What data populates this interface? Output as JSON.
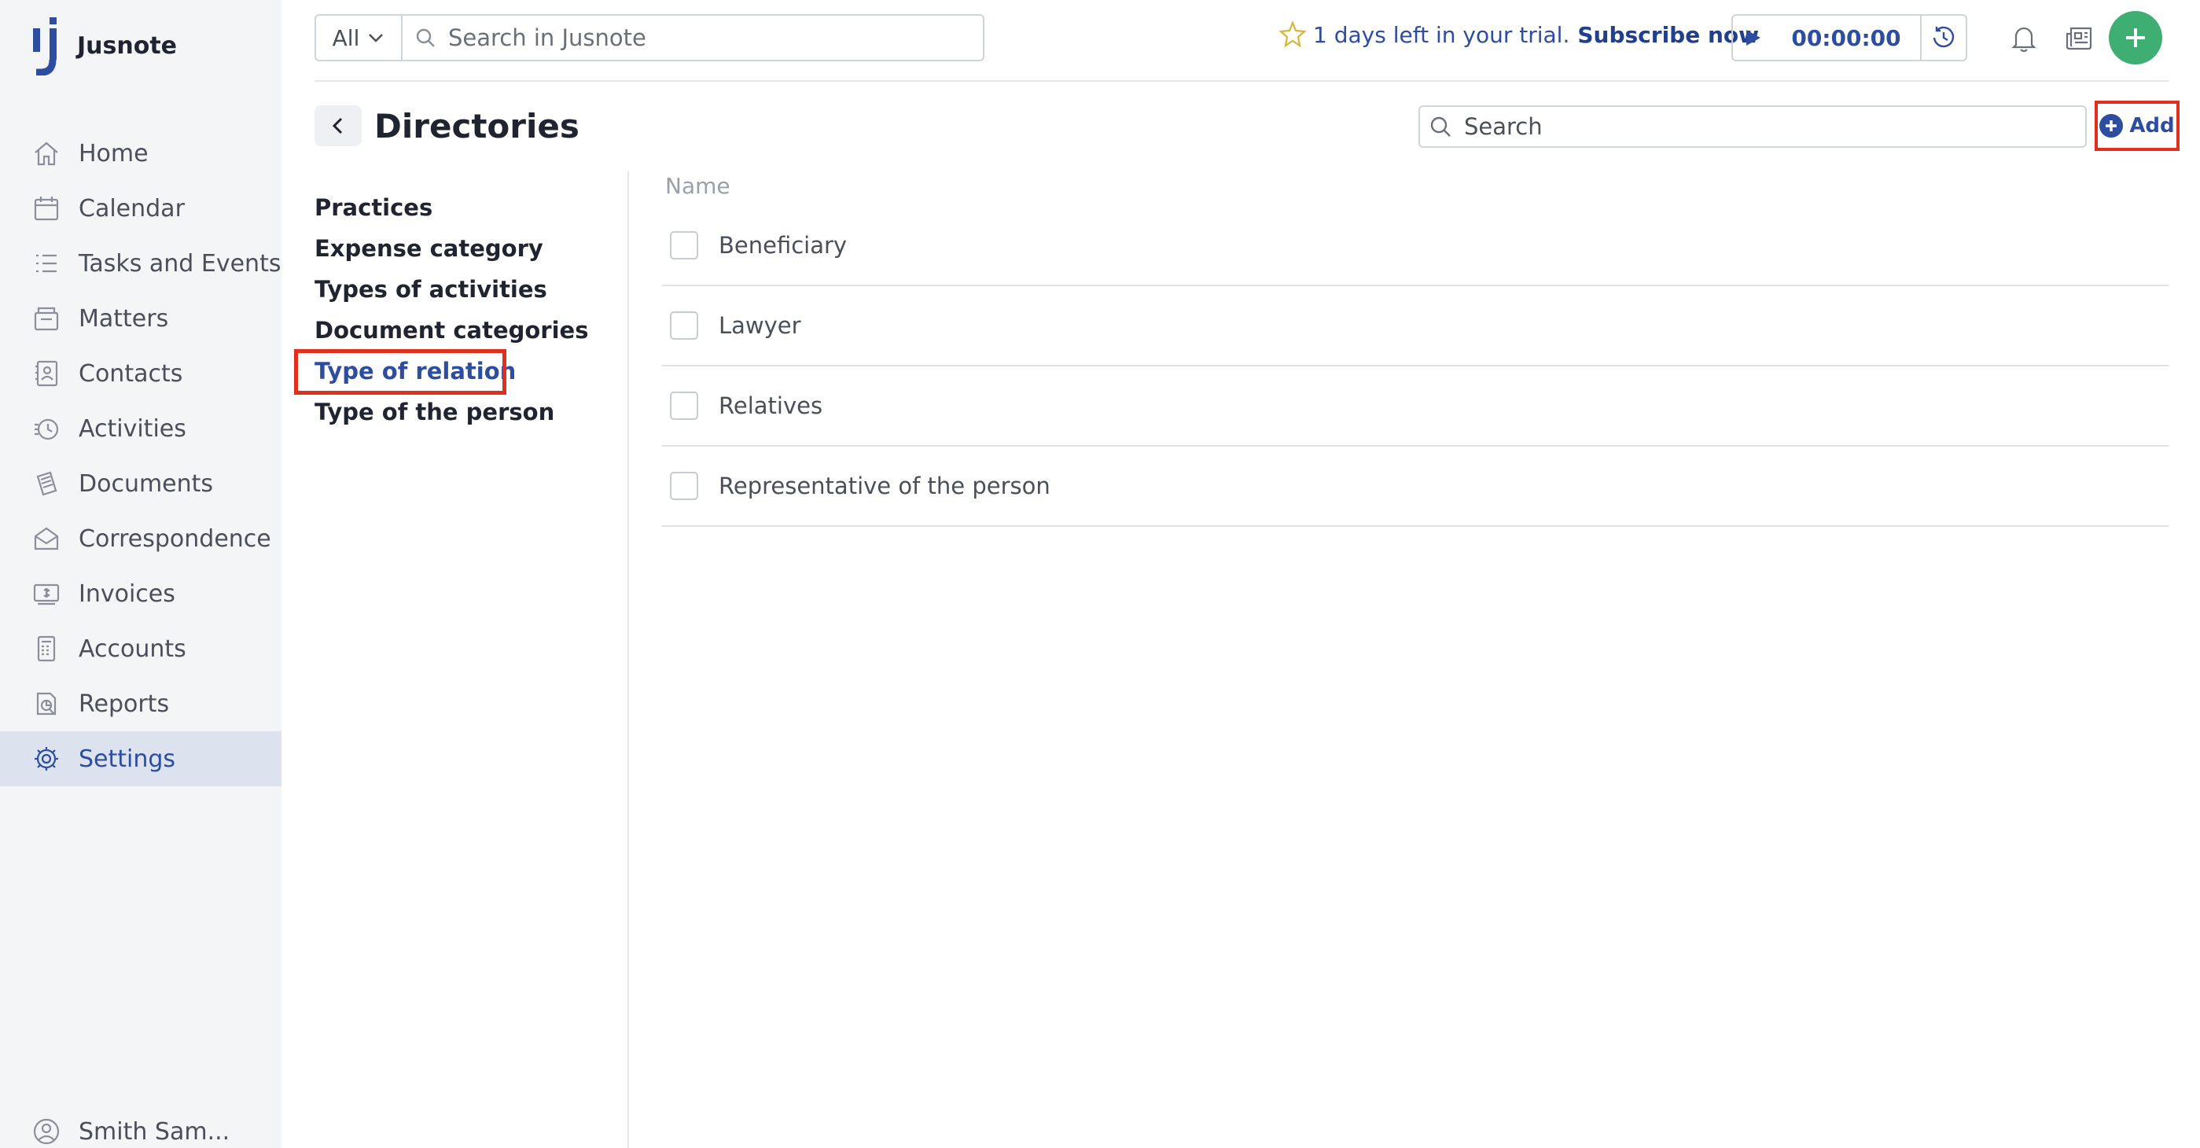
{
  "app": {
    "name": "Jusnote"
  },
  "sidebar": {
    "items": [
      {
        "label": "Home",
        "icon": "home-icon"
      },
      {
        "label": "Calendar",
        "icon": "calendar-icon"
      },
      {
        "label": "Tasks and Events",
        "icon": "tasks-icon"
      },
      {
        "label": "Matters",
        "icon": "matters-icon"
      },
      {
        "label": "Contacts",
        "icon": "contacts-icon"
      },
      {
        "label": "Activities",
        "icon": "activities-icon"
      },
      {
        "label": "Documents",
        "icon": "documents-icon"
      },
      {
        "label": "Correspondence",
        "icon": "correspondence-icon"
      },
      {
        "label": "Invoices",
        "icon": "invoices-icon"
      },
      {
        "label": "Accounts",
        "icon": "accounts-icon"
      },
      {
        "label": "Reports",
        "icon": "reports-icon"
      },
      {
        "label": "Settings",
        "icon": "gear-icon",
        "active": true
      }
    ],
    "user": {
      "name": "Smith Sam..."
    }
  },
  "topbar": {
    "scope_label": "All",
    "search_placeholder": "Search in Jusnote",
    "trial_text": "1 days left in your trial.",
    "subscribe_label": "Subscribe now",
    "timer_value": "00:00:00"
  },
  "page": {
    "title": "Directories",
    "search_placeholder": "Search",
    "add_label": "Add"
  },
  "directories": {
    "items": [
      {
        "label": "Practices"
      },
      {
        "label": "Expense category"
      },
      {
        "label": "Types of activities"
      },
      {
        "label": "Document categories"
      },
      {
        "label": "Type of relation",
        "active": true
      },
      {
        "label": "Type of the person"
      }
    ]
  },
  "table": {
    "column_name": "Name",
    "rows": [
      {
        "name": "Beneficiary"
      },
      {
        "name": "Lawyer"
      },
      {
        "name": "Relatives"
      },
      {
        "name": "Representative of the person"
      }
    ]
  },
  "colors": {
    "accent": "#2c4da0",
    "highlight": "#e02f1f",
    "fab": "#3fae73",
    "star": "#d9b43a"
  }
}
